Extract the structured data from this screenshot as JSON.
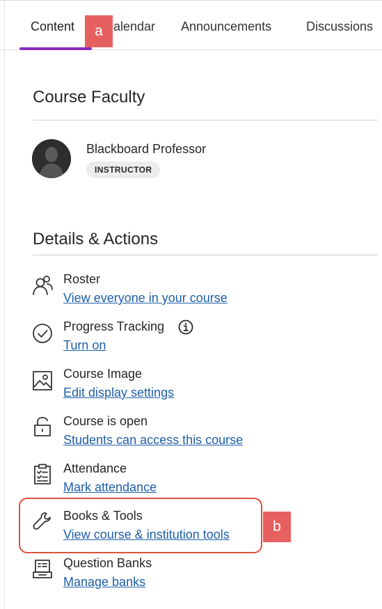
{
  "tabs": [
    {
      "label": "Content",
      "active": true
    },
    {
      "label": "Calendar",
      "active": false
    },
    {
      "label": "Announcements",
      "active": false
    },
    {
      "label": "Discussions",
      "active": false
    }
  ],
  "annotations": {
    "a": "a",
    "b": "b"
  },
  "course_faculty": {
    "title": "Course Faculty",
    "members": [
      {
        "name": "Blackboard Professor",
        "role": "INSTRUCTOR"
      }
    ]
  },
  "details": {
    "title": "Details & Actions",
    "items": [
      {
        "icon": "roster-icon",
        "title": "Roster",
        "link": "View everyone in your course"
      },
      {
        "icon": "progress-check-icon",
        "title": "Progress Tracking",
        "link": "Turn on",
        "info_icon": "info-icon"
      },
      {
        "icon": "image-icon",
        "title": "Course Image",
        "link": "Edit display settings"
      },
      {
        "icon": "unlock-icon",
        "title": "Course is open",
        "link": "Students can access this course"
      },
      {
        "icon": "attendance-clipboard-icon",
        "title": "Attendance",
        "link": "Mark attendance"
      },
      {
        "icon": "wrench-icon",
        "title": "Books & Tools",
        "link": "View course & institution tools",
        "highlighted": true
      },
      {
        "icon": "question-bank-icon",
        "title": "Question Banks",
        "link": "Manage banks"
      }
    ]
  },
  "colors": {
    "accent": "#8a2bb8",
    "link": "#1e5fa8",
    "badge": "#e76060",
    "highlight": "#e0503c"
  }
}
